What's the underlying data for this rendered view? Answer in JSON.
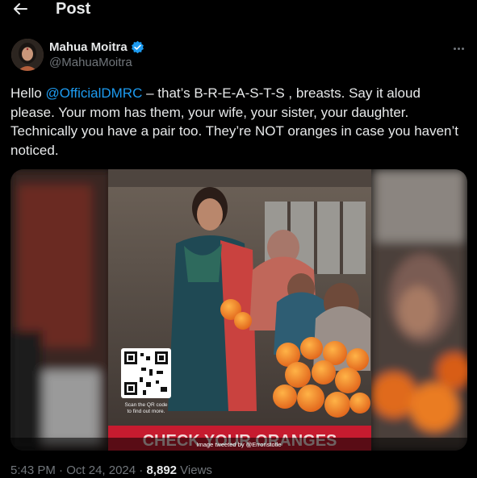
{
  "header": {
    "title": "Post"
  },
  "author": {
    "name": "Mahua Moitra",
    "handle": "@MahuaMoitra"
  },
  "tweet": {
    "greeting": "Hello ",
    "mention": "@OfficialDMRC",
    "body": " – that’s B-R-E-A-S-T-S , breasts. Say it aloud please. Your mom has them, your wife, your sister, your daughter. Technically you have a pair too. They’re NOT oranges in case you haven’t noticed."
  },
  "media": {
    "qr_caption": "Scan the QR code to find out more.",
    "banner_text": "CHECK YOUR ORANGES",
    "credit": "Image tweeted by @Erroristotle"
  },
  "meta": {
    "time": "5:43 PM",
    "separator": " · ",
    "date": "Oct 24, 2024",
    "views_count": "8,892",
    "views_label": " Views"
  },
  "colors": {
    "accent": "#1d9bf0",
    "verified": "#1d9bf0",
    "banner": "#c61b2f"
  }
}
